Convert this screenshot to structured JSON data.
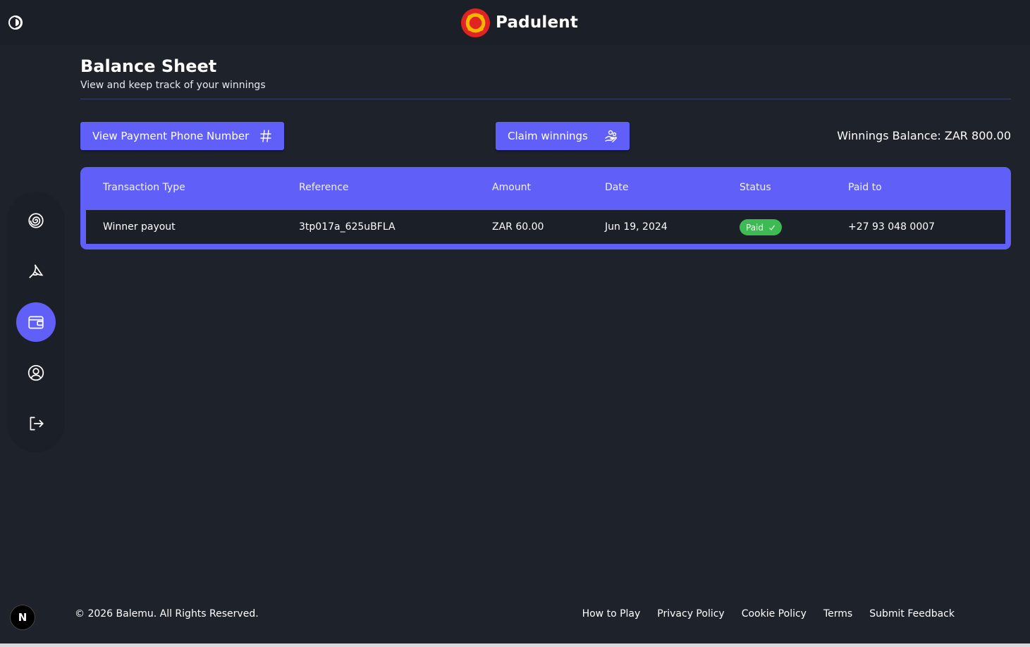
{
  "app": {
    "brand_name": "Padulent",
    "brand_color": "#6060f8"
  },
  "page": {
    "title": "Balance Sheet",
    "subtitle": "View and keep track of your winnings"
  },
  "actions": {
    "view_phone_label": "View Payment Phone Number",
    "claim_label": "Claim winnings"
  },
  "balance": {
    "text": "Winnings Balance: ZAR 800.00"
  },
  "table": {
    "columns": [
      "Transaction Type",
      "Reference",
      "Amount",
      "Date",
      "Status",
      "Paid to"
    ],
    "rows": [
      {
        "type": "Winner payout",
        "reference": "3tp017a_625uBFLA",
        "amount": "ZAR 60.00",
        "date": "Jun 19, 2024",
        "status": "Paid",
        "paid_to": "+27 93 048 0007"
      }
    ]
  },
  "sidebar": {
    "items": [
      {
        "icon": "spiral-icon"
      },
      {
        "icon": "banana-icon"
      },
      {
        "icon": "wallet-icon",
        "active": true
      },
      {
        "icon": "user-circle-icon"
      },
      {
        "icon": "logout-icon"
      }
    ]
  },
  "footer": {
    "copyright": "© 2026 Balemu. All Rights Reserved.",
    "links": [
      "How to Play",
      "Privacy Policy",
      "Cookie Policy",
      "Terms",
      "Submit Feedback"
    ]
  },
  "dev_badge": "N"
}
